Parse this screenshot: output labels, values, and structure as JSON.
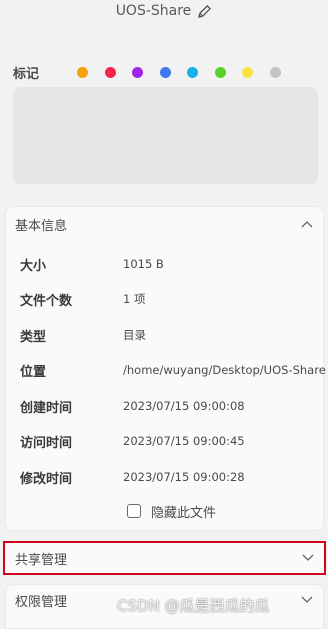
{
  "header": {
    "name": "UOS-Share",
    "edit_icon": "pencil-icon"
  },
  "tags": {
    "label": "标记",
    "colors": [
      {
        "name": "orange",
        "hex": "#f7a10f"
      },
      {
        "name": "red",
        "hex": "#f7224d"
      },
      {
        "name": "purple",
        "hex": "#a127e6"
      },
      {
        "name": "blue",
        "hex": "#3f79f0"
      },
      {
        "name": "cyan",
        "hex": "#17b0ec"
      },
      {
        "name": "green",
        "hex": "#57d228"
      },
      {
        "name": "yellow",
        "hex": "#f9e23f"
      },
      {
        "name": "gray",
        "hex": "#c4c4c4"
      }
    ]
  },
  "basic_info": {
    "title": "基本信息",
    "rows": [
      {
        "key": "大小",
        "value": "1015 B"
      },
      {
        "key": "文件个数",
        "value": "1 项"
      },
      {
        "key": "类型",
        "value": "目录"
      },
      {
        "key": "位置",
        "value": "/home/wuyang/Desktop/UOS-Share"
      },
      {
        "key": "创建时间",
        "value": "2023/07/15 09:00:08"
      },
      {
        "key": "访问时间",
        "value": "2023/07/15 09:00:45"
      },
      {
        "key": "修改时间",
        "value": "2023/07/15 09:00:28"
      }
    ],
    "hide_file_label": "隐藏此文件"
  },
  "share_management": {
    "title": "共享管理"
  },
  "permission_management": {
    "title": "权限管理"
  },
  "watermark": "CSDN @瓜是西瓜的瓜"
}
